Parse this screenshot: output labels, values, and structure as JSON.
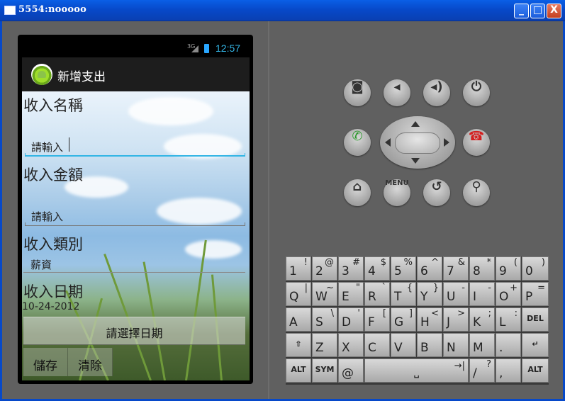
{
  "window": {
    "title": "5554:nooooo",
    "minimize": "_",
    "maximize": "□",
    "close": "X"
  },
  "status_bar": {
    "network": "3G",
    "time": "12:57"
  },
  "action_bar": {
    "title": "新增支出"
  },
  "form": {
    "name_label": "收入名稱",
    "name_value": "請輸入",
    "amount_label": "收入金額",
    "amount_value": "請輸入",
    "category_label": "收入類別",
    "category_value": "薪資",
    "date_label": "收入日期",
    "date_value": "10-24-2012",
    "pick_date_button": "請選擇日期",
    "save_button": "儲存",
    "clear_button": "清除"
  },
  "hardware": {
    "menu_label": "MENU"
  },
  "keyboard": {
    "rows": [
      [
        {
          "m": "1",
          "a": "!"
        },
        {
          "m": "2",
          "a": "@"
        },
        {
          "m": "3",
          "a": "#"
        },
        {
          "m": "4",
          "a": "$"
        },
        {
          "m": "5",
          "a": "%"
        },
        {
          "m": "6",
          "a": "^"
        },
        {
          "m": "7",
          "a": "&"
        },
        {
          "m": "8",
          "a": "*"
        },
        {
          "m": "9",
          "a": "("
        },
        {
          "m": "0",
          "a": ")"
        }
      ],
      [
        {
          "m": "Q",
          "a": "|"
        },
        {
          "m": "W",
          "a": "~"
        },
        {
          "m": "E",
          "a": "\""
        },
        {
          "m": "R",
          "a": "`"
        },
        {
          "m": "T",
          "a": "{"
        },
        {
          "m": "Y",
          "a": "}"
        },
        {
          "m": "U",
          "a": "-"
        },
        {
          "m": "I",
          "a": "-"
        },
        {
          "m": "O",
          "a": "+"
        },
        {
          "m": "P",
          "a": "="
        }
      ],
      [
        {
          "m": "A",
          "a": ""
        },
        {
          "m": "S",
          "a": "\\"
        },
        {
          "m": "D",
          "a": "'"
        },
        {
          "m": "F",
          "a": "["
        },
        {
          "m": "G",
          "a": "]"
        },
        {
          "m": "H",
          "a": "<"
        },
        {
          "m": "J",
          "a": ">"
        },
        {
          "m": "K",
          "a": ";"
        },
        {
          "m": "L",
          "a": ":"
        },
        {
          "c": "DEL"
        }
      ],
      [
        {
          "c": "⇧"
        },
        {
          "m": "Z",
          "a": ""
        },
        {
          "m": "X",
          "a": ""
        },
        {
          "m": "C",
          "a": ""
        },
        {
          "m": "V",
          "a": ""
        },
        {
          "m": "B",
          "a": ""
        },
        {
          "m": "N",
          "a": ""
        },
        {
          "m": "M",
          "a": ""
        },
        {
          "m": ".",
          "a": ""
        },
        {
          "c": "↵"
        }
      ]
    ],
    "bottom": {
      "alt_left": "ALT",
      "sym": "SYM",
      "at": "@",
      "space": "␣",
      "tab": "→|",
      "slash": "/",
      "question": "?",
      "comma": ",",
      "alt_right": "ALT"
    }
  }
}
